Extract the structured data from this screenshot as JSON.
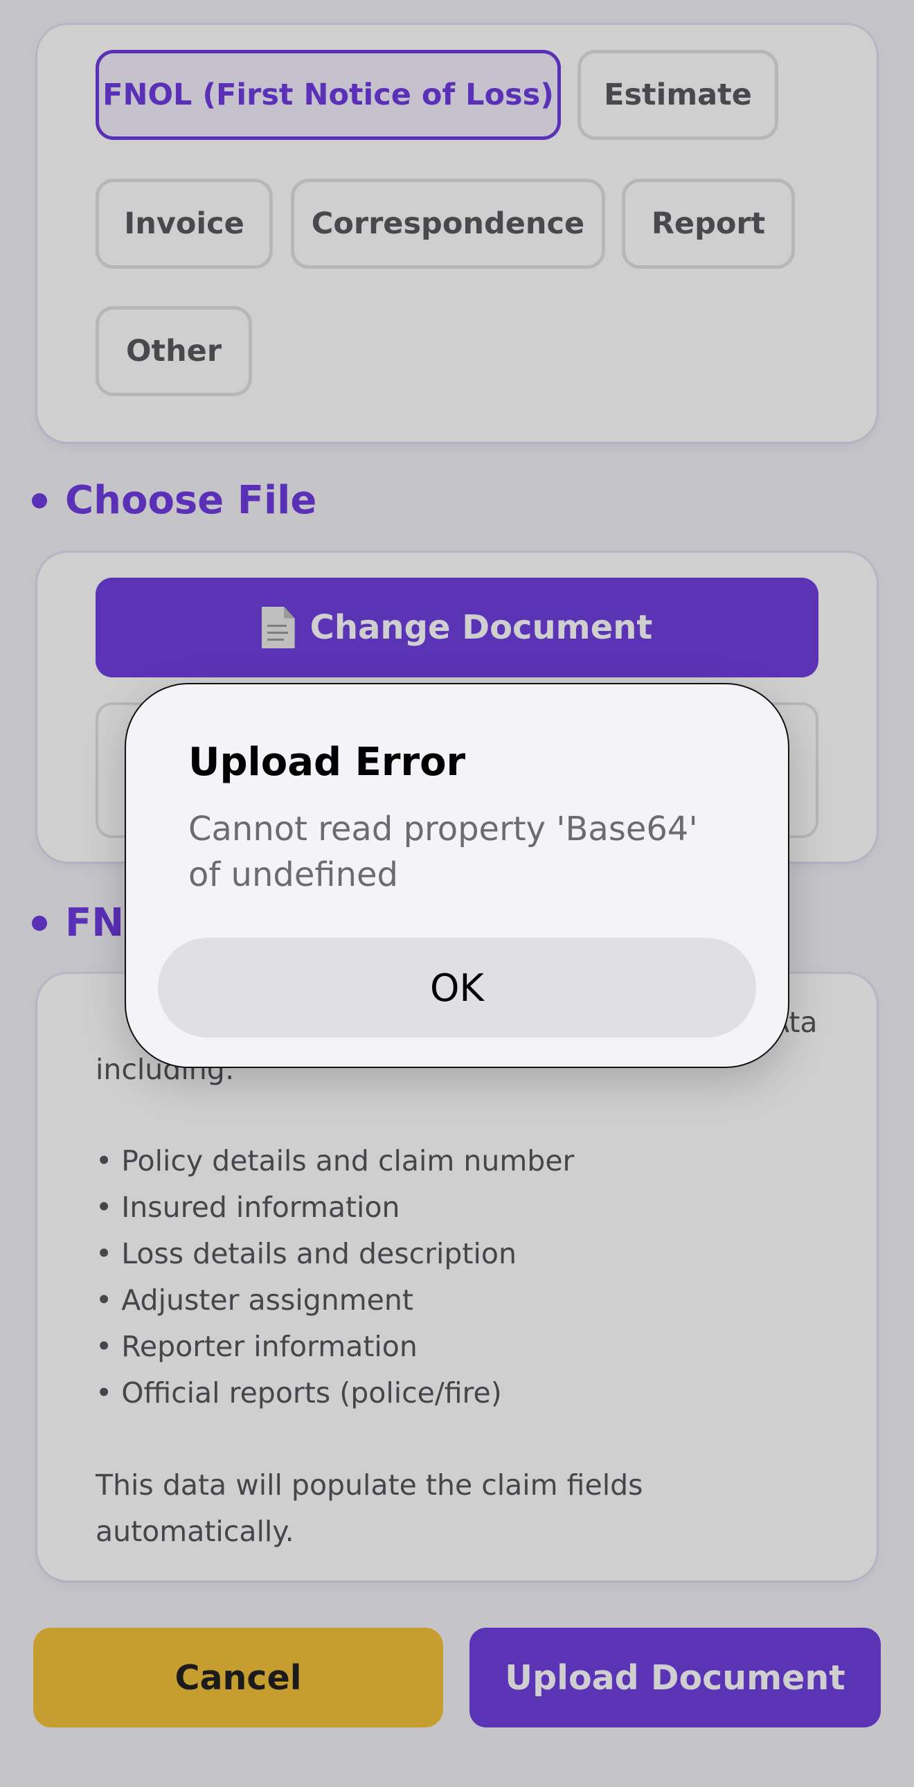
{
  "doc_types": {
    "chips": [
      {
        "label": "FNOL (First Notice of Loss)",
        "selected": true
      },
      {
        "label": "Estimate",
        "selected": false
      },
      {
        "label": "Invoice",
        "selected": false
      },
      {
        "label": "Correspondence",
        "selected": false
      },
      {
        "label": "Report",
        "selected": false
      },
      {
        "label": "Other",
        "selected": false
      }
    ]
  },
  "choose_file": {
    "title": "Choose File",
    "change_button_label": "Change Document",
    "change_button_icon": "document-icon"
  },
  "fnol_section": {
    "intro_line1": "Ata",
    "intro_line2": "including:",
    "bullets": [
      "• Policy details and claim number",
      "• Insured information",
      "• Loss details and description",
      "• Adjuster assignment",
      "• Reporter information",
      "• Official reports (police/fire)"
    ],
    "footer_line1": "This data will populate the claim fields",
    "footer_line2": "automatically."
  },
  "actions": {
    "cancel_label": "Cancel",
    "upload_label": "Upload Document"
  },
  "dialog": {
    "title": "Upload Error",
    "message": "Cannot read property 'Base64' of undefined",
    "ok_label": "OK"
  },
  "colors": {
    "accent": "#6f3ce0",
    "primary_button": "#7040e0",
    "cancel_button": "#f4c23a",
    "background": "#f3f2f7"
  }
}
